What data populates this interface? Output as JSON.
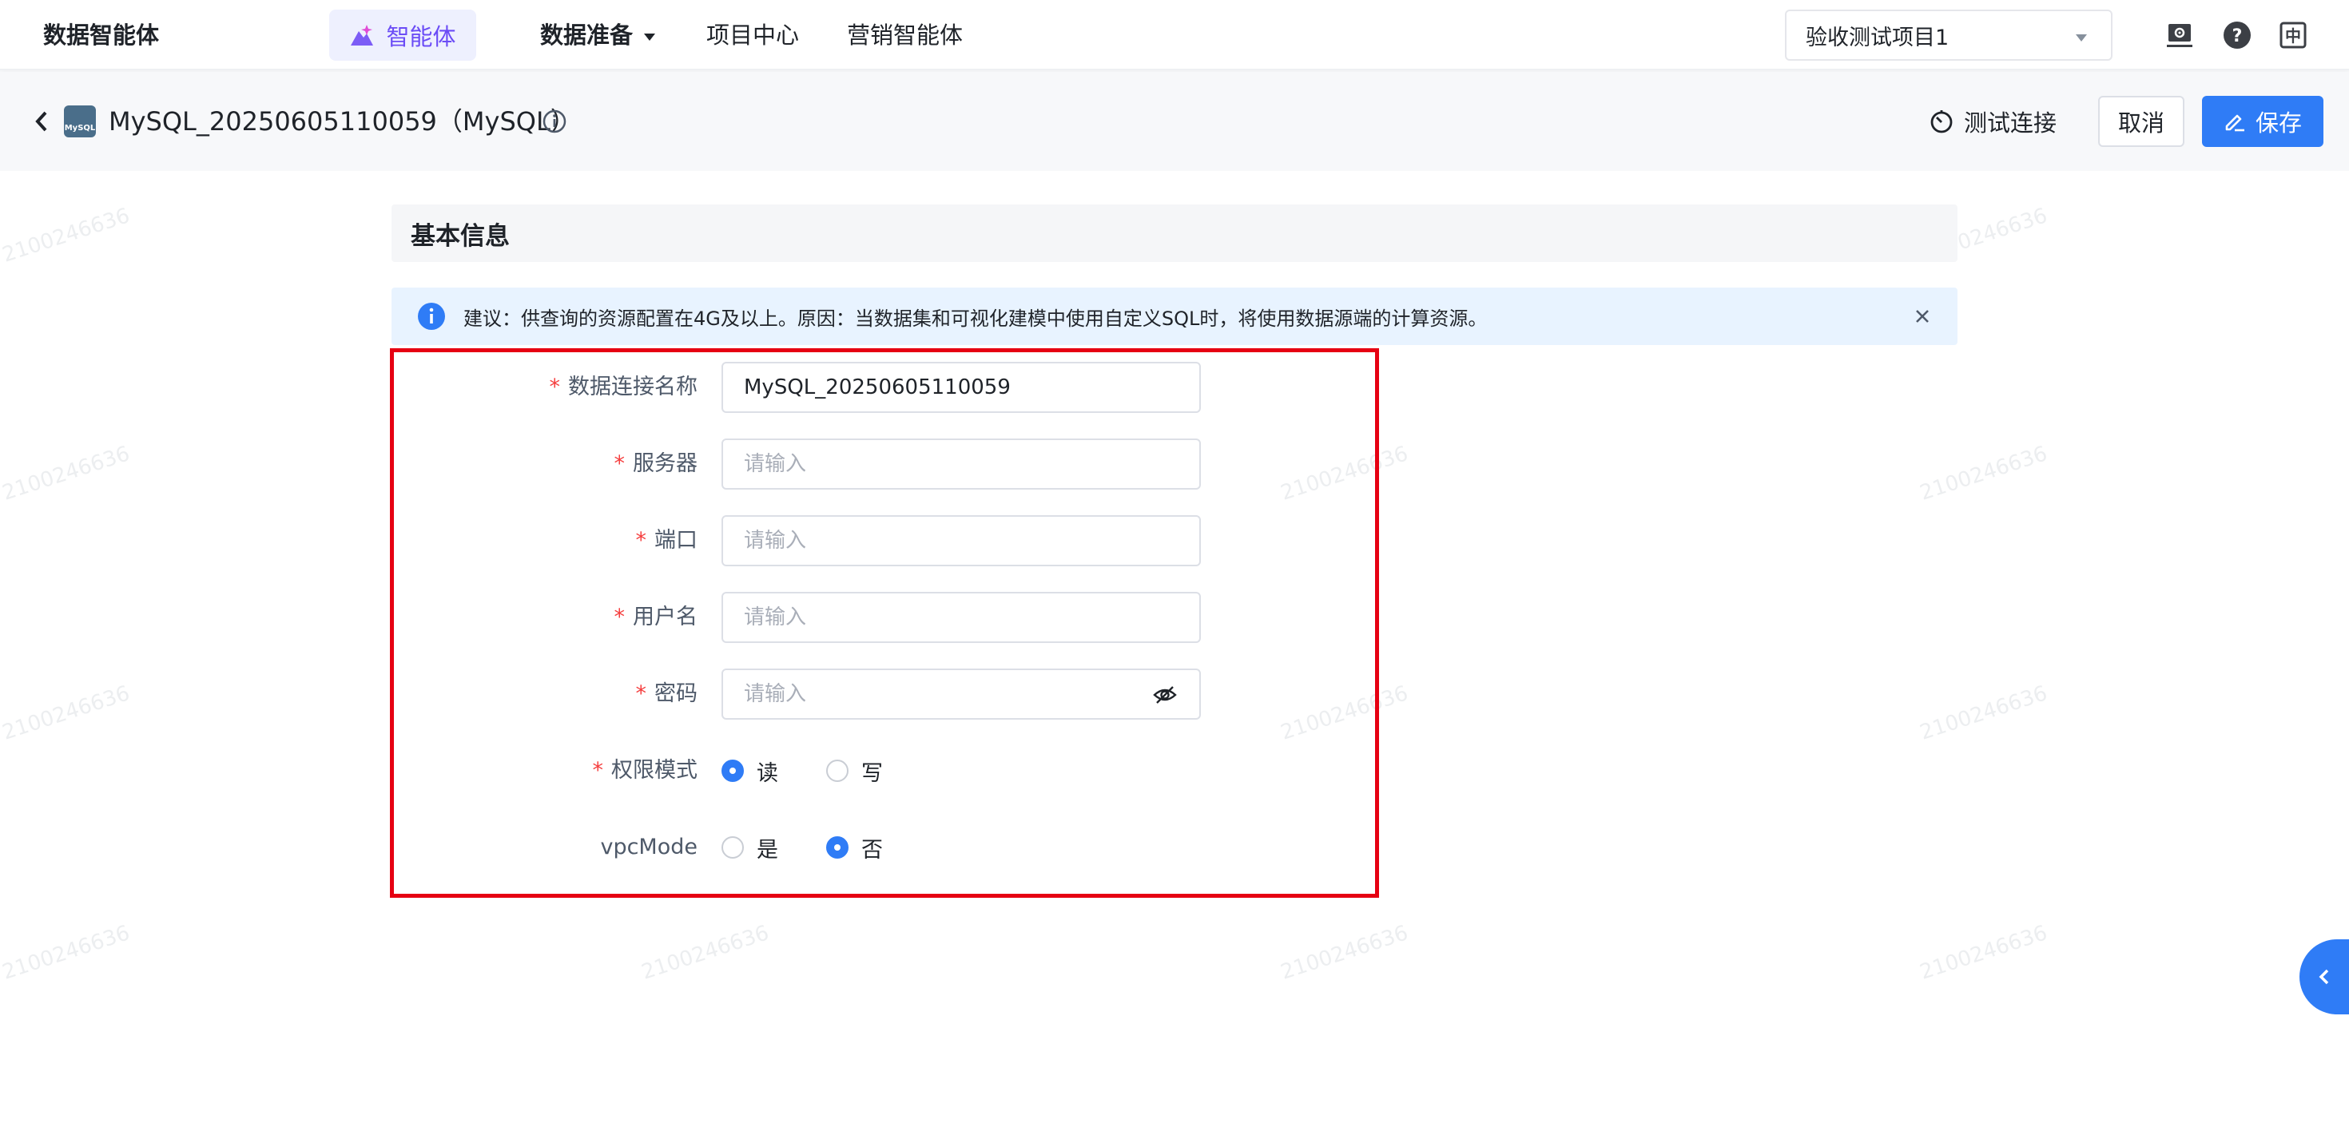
{
  "topnav": {
    "brand": "数据智能体",
    "agent_label": "智能体",
    "items": [
      {
        "label": "数据准备"
      },
      {
        "label": "项目中心"
      },
      {
        "label": "营销智能体"
      }
    ],
    "project": "验收测试项目1",
    "lang_glyph": "中"
  },
  "page": {
    "title": "MySQL_20250605110059（MySQL）",
    "logo_text": "MySQL",
    "test_connection": "测试连接",
    "cancel": "取消",
    "save": "保存"
  },
  "section": {
    "title": "基本信息",
    "alert": "建议：供查询的资源配置在4G及以上。原因：当数据集和可视化建模中使用自定义SQL时，将使用数据源端的计算资源。"
  },
  "form": {
    "required_mark": "*",
    "name": {
      "label": "数据连接名称",
      "value": "MySQL_20250605110059"
    },
    "server": {
      "label": "服务器",
      "placeholder": "请输入"
    },
    "port": {
      "label": "端口",
      "placeholder": "请输入"
    },
    "username": {
      "label": "用户名",
      "placeholder": "请输入"
    },
    "password": {
      "label": "密码",
      "placeholder": "请输入"
    },
    "permission": {
      "label": "权限模式",
      "options": [
        "读",
        "写"
      ],
      "selected": "读"
    },
    "vpc": {
      "label": "vpcMode",
      "options": [
        "是",
        "否"
      ],
      "selected": "否"
    }
  },
  "watermark": "2100246636",
  "colors": {
    "primary": "#2f7cf6",
    "agent_purple": "#6b4cf6",
    "required": "#f53f3f",
    "highlight_frame": "#e60012",
    "alert_bg": "#e8f3ff"
  }
}
